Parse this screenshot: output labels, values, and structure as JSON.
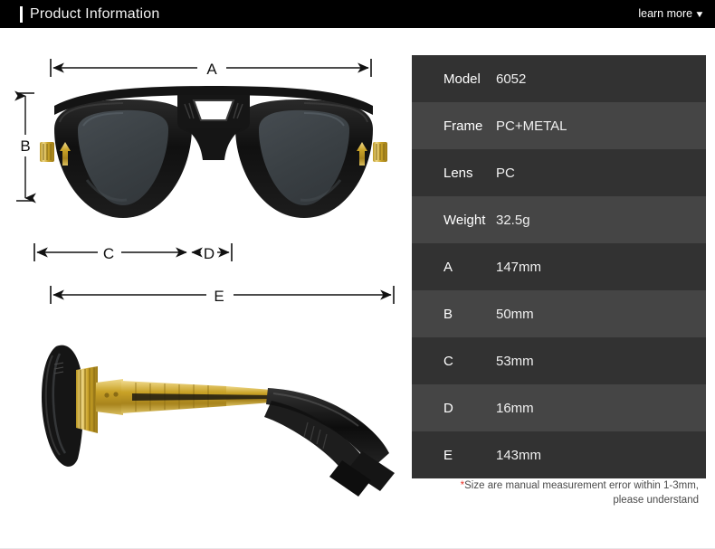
{
  "header": {
    "title": "Product Information",
    "learn_more_label": "learn more",
    "caret_icon": "chevron-down-icon"
  },
  "diagram": {
    "front_view": {
      "alt": "sunglasses-front-view",
      "dimension_labels": [
        "A",
        "B",
        "C",
        "D"
      ]
    },
    "side_view": {
      "alt": "sunglasses-side-view",
      "dimension_labels": [
        "E"
      ]
    },
    "labels": {
      "a": "A",
      "b": "B",
      "c": "C",
      "d": "D",
      "e": "E"
    },
    "colors": {
      "frame": "#141414",
      "lens": "#3a4044",
      "gold": "#c9a227",
      "line": "#111111"
    }
  },
  "spec_table": {
    "rows": [
      {
        "label": "Model",
        "value": "6052"
      },
      {
        "label": "Frame",
        "value": "PC+METAL"
      },
      {
        "label": "Lens",
        "value": "PC"
      },
      {
        "label": "Weight",
        "value": "32.5g"
      },
      {
        "label": "A",
        "value": "147mm"
      },
      {
        "label": "B",
        "value": "50mm"
      },
      {
        "label": "C",
        "value": "53mm"
      },
      {
        "label": "D",
        "value": "16mm"
      },
      {
        "label": "E",
        "value": "143mm"
      }
    ],
    "row_colors": {
      "odd": "#323232",
      "even": "#454545"
    }
  },
  "note": {
    "star": "*",
    "line1": "Size are manual measurement error within 1-3mm,",
    "line2": "please understand"
  }
}
